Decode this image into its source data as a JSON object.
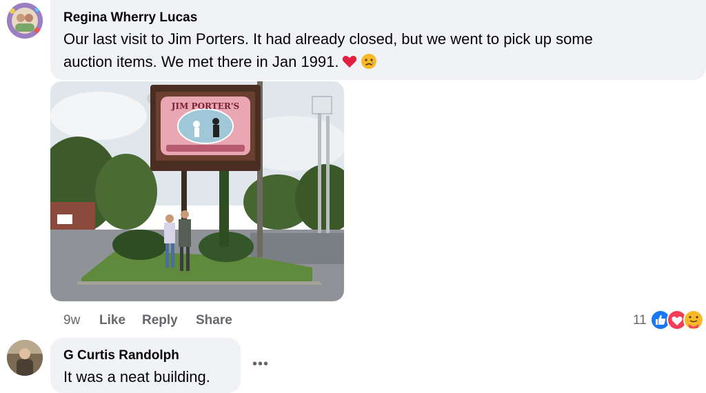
{
  "comment1": {
    "author": "Regina Wherry Lucas",
    "text_line1": "Our last visit to Jim Porters. It had already closed, but we went to pick up some",
    "text_line2": "auction items. We met there in Jan 1991.",
    "emojis": [
      "red-heart",
      "sad-tear"
    ],
    "photo_sign_text": "JIM PORTER'S",
    "time": "9w",
    "like_label": "Like",
    "reply_label": "Reply",
    "share_label": "Share",
    "reaction_count": "11",
    "reactions": [
      "like",
      "love",
      "care"
    ]
  },
  "comment2": {
    "author": "G Curtis Randolph",
    "text": "It was a neat building.",
    "more_label": "•••"
  }
}
